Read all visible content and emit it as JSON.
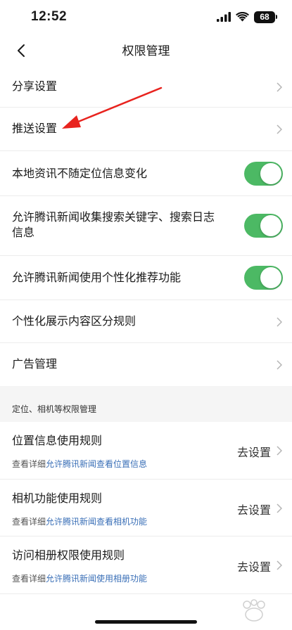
{
  "status": {
    "time": "12:52",
    "battery": "68"
  },
  "nav": {
    "title": "权限管理"
  },
  "rows": {
    "share": "分享设置",
    "push": "推送设置",
    "local_news": "本地资讯不随定位信息变化",
    "search_collect": "允许腾讯新闻收集搜索关键字、搜索日志信息",
    "personalized": "允许腾讯新闻使用个性化推荐功能",
    "display_rules": "个性化展示内容区分规则",
    "ads": "广告管理"
  },
  "toggles": {
    "local_news_on": true,
    "search_collect_on": true,
    "personalized_on": true
  },
  "section": {
    "title": "定位、相机等权限管理"
  },
  "permissions": [
    {
      "title": "位置信息使用规则",
      "sub_prefix": "查看详细",
      "sub_link": "允许腾讯新闻查看位置信息",
      "action": "去设置"
    },
    {
      "title": "相机功能使用规则",
      "sub_prefix": "查看详细",
      "sub_link": "允许腾讯新闻查看相机功能",
      "action": "去设置"
    },
    {
      "title": "访问相册权限使用规则",
      "sub_prefix": "查看详细",
      "sub_link": "允许腾讯新闻使用相册功能",
      "action": "去设置"
    }
  ],
  "colors": {
    "toggle_on": "#4cb964",
    "link": "#3a6fb7",
    "annotation_arrow": "#e8231e",
    "section_bg": "#f5f5f5"
  }
}
